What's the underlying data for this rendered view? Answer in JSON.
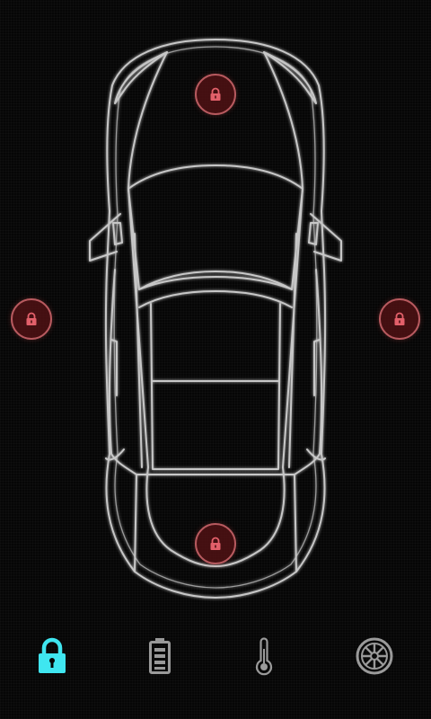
{
  "app": {
    "accent_color": "#3fe6f0",
    "inactive_color": "#9a9a9a",
    "lock_ring_color": "#b85a5f",
    "lock_fill_color": "#501214"
  },
  "car": {
    "view": "top-down",
    "outline_color": "#d8d8d8"
  },
  "door_locks": [
    {
      "position": "front",
      "state": "locked",
      "icon": "padlock-icon"
    },
    {
      "position": "left",
      "state": "locked",
      "icon": "padlock-icon"
    },
    {
      "position": "right",
      "state": "locked",
      "icon": "padlock-icon"
    },
    {
      "position": "rear",
      "state": "locked",
      "icon": "padlock-icon"
    }
  ],
  "bottom_nav": {
    "items": [
      {
        "id": "lock",
        "icon": "padlock-icon",
        "active": true
      },
      {
        "id": "battery",
        "icon": "battery-icon",
        "active": false
      },
      {
        "id": "climate",
        "icon": "thermometer-icon",
        "active": false
      },
      {
        "id": "tires",
        "icon": "wheel-icon",
        "active": false
      }
    ]
  }
}
